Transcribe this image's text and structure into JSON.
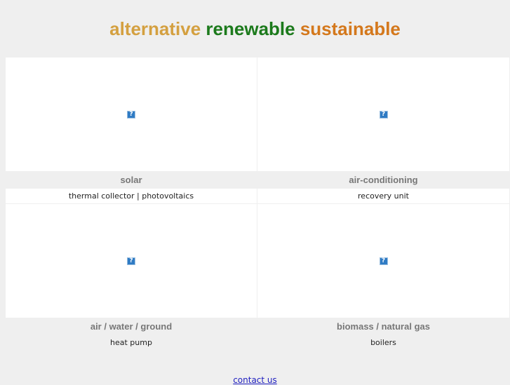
{
  "header": {
    "word1": "alternative",
    "word2": "renewable",
    "word3": "sustainable",
    "colors": {
      "word1": "#d4a040",
      "word2": "#1c7a1c",
      "word3": "#d4781c"
    }
  },
  "cards": [
    {
      "image_placeholder": "?",
      "title": "solar",
      "subtitle": "thermal collector | photovoltaics"
    },
    {
      "image_placeholder": "?",
      "title": "air-conditioning",
      "subtitle": "recovery unit"
    },
    {
      "image_placeholder": "?",
      "title": "air / water / ground",
      "subtitle": "heat pump"
    },
    {
      "image_placeholder": "?",
      "title": "biomass / natural gas",
      "subtitle": "boilers"
    }
  ],
  "footer": {
    "contact_label": "contact us"
  }
}
